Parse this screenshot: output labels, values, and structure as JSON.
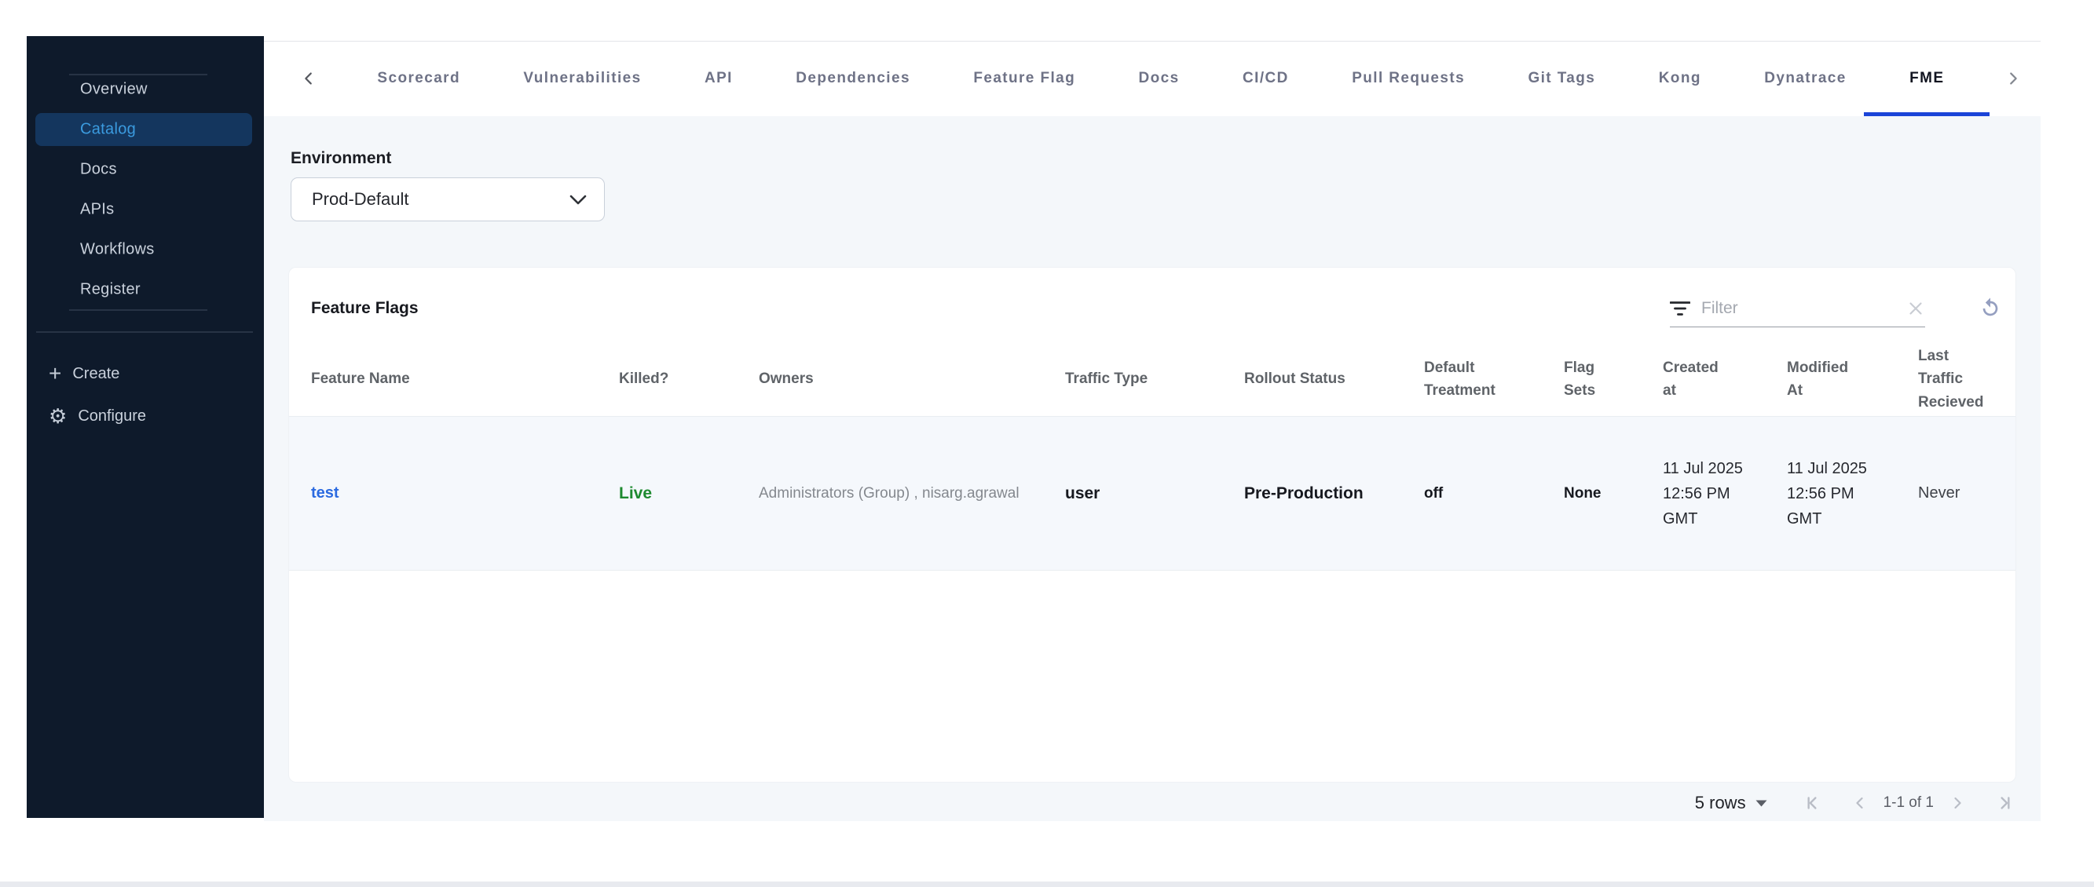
{
  "sidebar": {
    "items": [
      "Overview",
      "Catalog",
      "Docs",
      "APIs",
      "Workflows",
      "Register"
    ],
    "active_item": "Catalog",
    "create_label": "Create",
    "configure_label": "Configure"
  },
  "tabs": {
    "items": [
      "Scorecard",
      "Vulnerabilities",
      "API",
      "Dependencies",
      "Feature Flag",
      "Docs",
      "CI/CD",
      "Pull Requests",
      "Git Tags",
      "Kong",
      "Dynatrace",
      "FME"
    ],
    "active": "FME"
  },
  "environment": {
    "label": "Environment",
    "value": "Prod-Default"
  },
  "feature_flags": {
    "title": "Feature Flags",
    "filter_placeholder": "Filter",
    "columns": [
      "Feature Name",
      "Killed?",
      "Owners",
      "Traffic Type",
      "Rollout Status",
      "Default Treatment",
      "Flag Sets",
      "Created at",
      "Modified At",
      "Last Traffic Recieved"
    ],
    "rows": [
      {
        "feature_name": "test",
        "killed": "Live",
        "owners": "Administrators (Group) , nisarg.agrawal",
        "traffic_type": "user",
        "rollout_status": "Pre-Production",
        "default_treatment": "off",
        "flag_sets": "None",
        "created_at": "11 Jul 2025 12:56 PM GMT",
        "modified_at": "11 Jul 2025 12:56 PM GMT",
        "last_traffic_received": "Never"
      }
    ]
  },
  "pagination": {
    "rows_per_page": "5 rows",
    "range_label": "1-1 of 1"
  },
  "icons": {
    "gear": "⚙",
    "plus": "+"
  },
  "colors": {
    "sidebar_bg": "#0e1a2b",
    "sidebar_active_bg": "#14365e",
    "sidebar_active_text": "#3b9bdf",
    "tab_active_underline": "#1b44d8",
    "link_blue": "#2b6ae0",
    "live_green": "#1e8a2f",
    "content_bg": "#f4f7fa"
  }
}
